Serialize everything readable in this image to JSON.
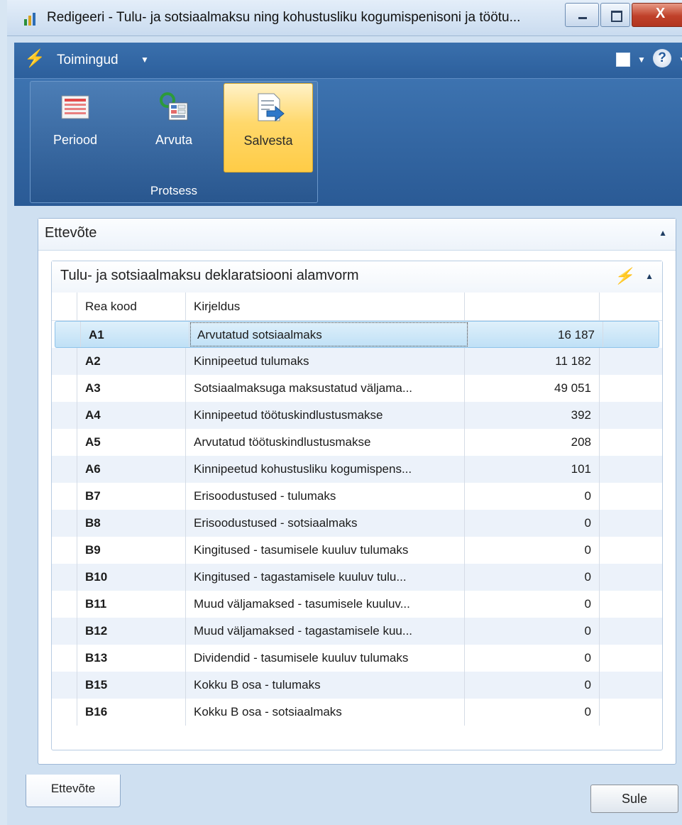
{
  "window": {
    "title": "Redigeeri - Tulu- ja sotsiaalmaksu ning kohustusliku kogumispenisoni ja töötu...",
    "min_glyph": "",
    "max_glyph": "",
    "close_glyph": "X"
  },
  "actions": {
    "menu_label": "Toimingud",
    "help_glyph": "?"
  },
  "ribbon": {
    "group_label": "Protsess",
    "buttons": [
      {
        "label": "Periood",
        "icon": "calendar-grid-icon"
      },
      {
        "label": "Arvuta",
        "icon": "calculate-icon"
      },
      {
        "label": "Salvesta",
        "icon": "save-export-icon"
      }
    ]
  },
  "fasttab": {
    "title": "Ettevõte"
  },
  "subform": {
    "title": "Tulu- ja sotsiaalmaksu deklaratsiooni alamvorm",
    "columns": [
      "Rea kood",
      "Kirjeldus",
      "",
      ""
    ],
    "rows": [
      {
        "code": "A1",
        "desc": "Arvutatud sotsiaalmaks",
        "value": "16 187"
      },
      {
        "code": "A2",
        "desc": "Kinnipeetud tulumaks",
        "value": "11 182"
      },
      {
        "code": "A3",
        "desc": "Sotsiaalmaksuga maksustatud väljama...",
        "value": "49 051"
      },
      {
        "code": "A4",
        "desc": "Kinnipeetud töötuskindlustusmakse",
        "value": "392"
      },
      {
        "code": "A5",
        "desc": "Arvutatud töötuskindlustusmakse",
        "value": "208"
      },
      {
        "code": "A6",
        "desc": "Kinnipeetud kohustusliku kogumispens...",
        "value": "101"
      },
      {
        "code": "B7",
        "desc": "Erisoodustused - tulumaks",
        "value": "0"
      },
      {
        "code": "B8",
        "desc": "Erisoodustused - sotsiaalmaks",
        "value": "0"
      },
      {
        "code": "B9",
        "desc": "Kingitused - tasumisele kuuluv tulumaks",
        "value": "0"
      },
      {
        "code": "B10",
        "desc": "Kingitused -  tagastamisele kuuluv tulu...",
        "value": "0"
      },
      {
        "code": "B11",
        "desc": "Muud väljamaksed - tasumisele kuuluv...",
        "value": "0"
      },
      {
        "code": "B12",
        "desc": "Muud väljamaksed - tagastamisele kuu...",
        "value": "0"
      },
      {
        "code": "B13",
        "desc": "Dividendid - tasumisele kuuluv tulumaks",
        "value": "0"
      },
      {
        "code": "B15",
        "desc": "Kokku B osa - tulumaks",
        "value": "0"
      },
      {
        "code": "B16",
        "desc": "Kokku B osa - sotsiaalmaks",
        "value": "0"
      }
    ],
    "selected_row": 0
  },
  "footer": {
    "tab_label": "Ettevõte",
    "close_label": "Sule"
  },
  "colors": {
    "accent": "#2c5f9c",
    "selection": "#bfe0f6",
    "active_button": "#ffd86b"
  }
}
